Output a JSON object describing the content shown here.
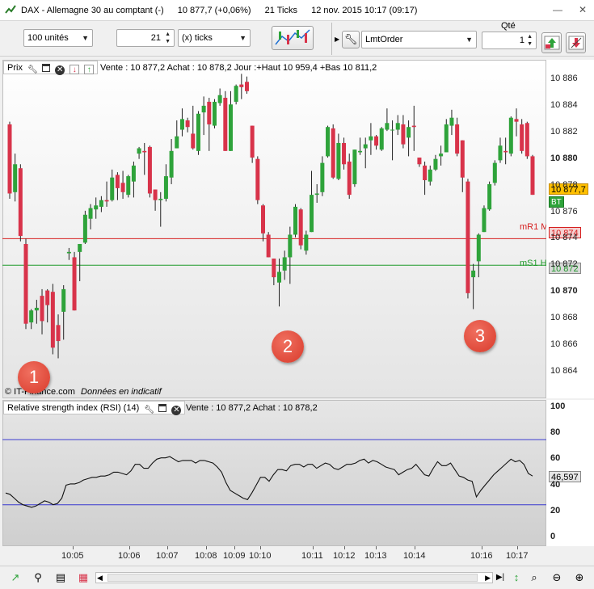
{
  "window": {
    "title_instrument": "DAX - Allemagne 30 au comptant (-)",
    "title_quote": "10 877,7 (+0,06%)",
    "title_ticks": "21 Ticks",
    "title_date": "12 nov. 2015 10:17 (09:17)"
  },
  "toolbar": {
    "units_select": "100 unités",
    "ticks_value": "21",
    "ticks_unit_select": "(x) ticks",
    "order_type_select": "LmtOrder",
    "qty_label": "Qté",
    "qty_value": "1"
  },
  "price_panel": {
    "label": "Prix",
    "info": "Vente : 10 877,2 Achat : 10 878,2 Jour :+Haut 10 959,4 +Bas 10 811,2",
    "watermark_source": "© IT-Finance.com",
    "watermark_note": "Données en indicatif",
    "line_mr1_label": "mR1 M",
    "line_ms1_label": "mS1 H",
    "line_mr1_value": 10874,
    "line_ms1_value": 10872
  },
  "price_axis": {
    "labels": [
      "10 886",
      "10 884",
      "10 882",
      "10 880",
      "10 878",
      "10 876",
      "10 874",
      "10 872",
      "10 870",
      "10 868",
      "10 866",
      "10 864"
    ],
    "bold_labels": [
      "10 880",
      "10 870"
    ],
    "current_tag": "10 877,7",
    "bt_tag": "BT",
    "mr1_tag": "10 874",
    "ms1_tag": "10 872"
  },
  "rsi_panel": {
    "label": "Relative strength index (RSI) (14)",
    "info": "Vente : 10 877,2 Achat : 10 878,2",
    "axis_labels": [
      "100",
      "80",
      "60",
      "40",
      "20",
      "0"
    ],
    "current_value": "46,597"
  },
  "time_axis": [
    "10:05",
    "10:06",
    "10:07",
    "10:08",
    "10:09",
    "10:10",
    "10:11",
    "10:12",
    "10:13",
    "10:14",
    "10:16",
    "10:17"
  ],
  "markers": [
    "1",
    "2",
    "3"
  ],
  "colors": {
    "up": "#2ea33a",
    "down": "#d8334a",
    "mr1": "#d62020",
    "ms1": "#1f9a2a",
    "rsi_bands": "#3a3ad0",
    "current_tag_bg": "#ffc000"
  },
  "chart_data": [
    {
      "type": "candlestick",
      "ylim": [
        10863,
        10887
      ],
      "candles": [
        [
          10882.6,
          10882.8,
          10877,
          10877.4
        ],
        [
          10877.5,
          10880.4,
          10876.8,
          10879.6
        ],
        [
          10879.3,
          10879.6,
          10873.8,
          10874.2
        ],
        [
          10873.6,
          10874,
          10867.2,
          10867.6
        ],
        [
          10867.7,
          10868.7,
          10867.2,
          10868.6
        ],
        [
          10868.6,
          10869.4,
          10867.6,
          10868.8
        ],
        [
          10869.7,
          10870.2,
          10866.8,
          10867.8
        ],
        [
          10870.1,
          10870.2,
          10867.7,
          10869
        ],
        [
          10870,
          10870.6,
          10865.3,
          10865.8
        ],
        [
          10867.5,
          10868.3,
          10865,
          10866.3
        ],
        [
          10868.5,
          10870.5,
          10866.4,
          10870.2
        ],
        [
          10872.9,
          10873.3,
          10872.4,
          10873
        ],
        [
          10872.6,
          10873,
          10868.6,
          10868.6
        ],
        [
          10873,
          10873.6,
          10870.8,
          10873.6
        ],
        [
          10873.7,
          10876.1,
          10873.6,
          10875.8
        ],
        [
          10875.5,
          10876.6,
          10874.7,
          10876.3
        ],
        [
          10876.2,
          10877.1,
          10875.5,
          10876.5
        ],
        [
          10876.4,
          10877.2,
          10876,
          10876.9
        ],
        [
          10876.9,
          10878.3,
          10876.4,
          10876.8
        ],
        [
          10876.9,
          10879.2,
          10876.8,
          10878.6
        ],
        [
          10878.8,
          10879,
          10876.9,
          10877.8
        ],
        [
          10878.2,
          10879.1,
          10877,
          10877.5
        ],
        [
          10877.3,
          10878.8,
          10877.1,
          10878.7
        ],
        [
          10878.3,
          10879.8,
          10877.1,
          10879.5
        ],
        [
          10880.4,
          10880.9,
          10880,
          10880.8
        ],
        [
          10880.6,
          10881.2,
          10878.8,
          10880.5
        ],
        [
          10880.9,
          10881,
          10877.1,
          10877.4
        ],
        [
          10877.7,
          10877.7,
          10876.1,
          10876.9
        ],
        [
          10876.9,
          10877.5,
          10874.9,
          10877
        ],
        [
          10877,
          10879.6,
          10876.8,
          10878.7
        ],
        [
          10878.6,
          10881.5,
          10878.1,
          10880.6
        ],
        [
          10880.8,
          10882.9,
          10880.8,
          10881.7
        ],
        [
          10882.2,
          10883.8,
          10881.7,
          10883
        ],
        [
          10882.9,
          10883.1,
          10882,
          10882.4
        ],
        [
          10881.9,
          10884,
          10880.7,
          10880.8
        ],
        [
          10880.6,
          10883.6,
          10880.3,
          10883.4
        ],
        [
          10883.5,
          10884.7,
          10881.8,
          10884
        ],
        [
          10884.3,
          10884.6,
          10880.6,
          10882.6
        ],
        [
          10882.5,
          10884.5,
          10882.3,
          10884.3
        ],
        [
          10884.2,
          10885.3,
          10884,
          10884.8
        ],
        [
          10884.6,
          10885.1,
          10880.6,
          10880.6
        ],
        [
          10880.6,
          10885.1,
          10880.6,
          10884.1
        ],
        [
          10884.3,
          10885.6,
          10884.1,
          10885.5
        ],
        [
          10885.6,
          10886.4,
          10884.5,
          10885.4
        ],
        [
          10885.8,
          10886.2,
          10884.9,
          10885.1
        ],
        [
          10882.5,
          10882.5,
          10879.7,
          10880.1
        ],
        [
          10880,
          10880.2,
          10876.6,
          10876.9
        ],
        [
          10876.5,
          10876.6,
          10873.8,
          10874.4
        ],
        [
          10874.3,
          10874.5,
          10872.6,
          10872.6
        ],
        [
          10872.5,
          10872.5,
          10870.5,
          10871.1
        ],
        [
          10870.7,
          10872.5,
          10868.9,
          10871.5
        ],
        [
          10871.6,
          10873.1,
          10870.9,
          10872.6
        ],
        [
          10872.6,
          10874.9,
          10870.6,
          10874.3
        ],
        [
          10874.3,
          10876.6,
          10874.1,
          10876.4
        ],
        [
          10876.2,
          10876.3,
          10873.2,
          10873.5
        ],
        [
          10873.1,
          10874.6,
          10872.8,
          10874.3
        ],
        [
          10874.5,
          10879.1,
          10874.5,
          10877.3
        ],
        [
          10877.3,
          10878.1,
          10876.7,
          10877.4
        ],
        [
          10877.5,
          10880.2,
          10877.2,
          10879.7
        ],
        [
          10880.2,
          10882.5,
          10880.1,
          10882.4
        ],
        [
          10882.3,
          10882.6,
          10878.5,
          10878.6
        ],
        [
          10878.5,
          10881.9,
          10878.4,
          10881.2
        ],
        [
          10881.2,
          10881.6,
          10879.2,
          10879.6
        ],
        [
          10879.8,
          10880.4,
          10877,
          10877.3
        ],
        [
          10878.1,
          10880.7,
          10877.9,
          10880.7
        ],
        [
          10880.5,
          10881.6,
          10880.3,
          10880.6
        ],
        [
          10880.8,
          10881.6,
          10879.3,
          10881.1
        ],
        [
          10881.4,
          10882.7,
          10880.3,
          10881.7
        ],
        [
          10881.7,
          10881.8,
          10880.7,
          10881
        ],
        [
          10880.7,
          10882.4,
          10880.6,
          10882.3
        ],
        [
          10882.2,
          10883.8,
          10882.1,
          10882.7
        ],
        [
          10882.2,
          10882.9,
          10879.9,
          10882.2
        ],
        [
          10882.2,
          10883.3,
          10881.8,
          10882.7
        ],
        [
          10882.6,
          10883.3,
          10880.8,
          10881.1
        ],
        [
          10881.6,
          10882.9,
          10880.2,
          10882.4
        ],
        [
          10882.5,
          10884,
          10880.6,
          10882.4
        ],
        [
          10880.1,
          10880.1,
          10879.4,
          10879.6
        ],
        [
          10879.5,
          10879.8,
          10877.3,
          10878.4
        ],
        [
          10878.3,
          10879.5,
          10878,
          10879.2
        ],
        [
          10879.2,
          10880.3,
          10879.1,
          10880
        ],
        [
          10880.2,
          10881,
          10879.5,
          10880.4
        ],
        [
          10880.5,
          10883,
          10880.5,
          10882.6
        ],
        [
          10882.5,
          10883.7,
          10881.8,
          10883.1
        ],
        [
          10882.6,
          10883.1,
          10880.2,
          10880.4
        ],
        [
          10881.4,
          10881.4,
          10877.5,
          10878.6
        ],
        [
          10878.3,
          10878.5,
          10869.5,
          10869.9
        ],
        [
          10871.1,
          10872.1,
          10868.7,
          10871.6
        ],
        [
          10872.3,
          10874.4,
          10871.1,
          10874.3
        ],
        [
          10874.5,
          10876.5,
          10874.5,
          10876.3
        ],
        [
          10876.2,
          10878.3,
          10876.1,
          10878.1
        ],
        [
          10878.2,
          10879.9,
          10878,
          10879.7
        ],
        [
          10879.9,
          10881.6,
          10879.7,
          10881
        ],
        [
          10880.6,
          10881.6,
          10879.6,
          10880.5
        ],
        [
          10880.4,
          10883.2,
          10880.2,
          10883.1
        ],
        [
          10883,
          10883.8,
          10881.7,
          10882.8
        ],
        [
          10882.6,
          10883,
          10880.4,
          10880.6
        ],
        [
          10882.7,
          10882.8,
          10880,
          10880.2
        ],
        [
          10880.2,
          10880.3,
          10877.3,
          10877.3
        ]
      ]
    },
    {
      "type": "line",
      "name": "RSI",
      "ylim": [
        0,
        100
      ],
      "bands": [
        75,
        25
      ],
      "values": [
        34,
        33,
        30,
        27,
        25,
        24,
        23,
        24,
        26,
        28,
        27,
        25,
        26,
        30,
        40,
        41,
        41,
        42,
        44,
        45,
        46,
        46,
        47,
        47,
        48,
        50,
        50,
        49,
        48,
        51,
        56,
        56,
        53,
        53,
        57,
        60,
        61,
        61,
        62,
        60,
        58,
        59,
        59,
        59,
        57,
        59,
        59,
        58,
        57,
        54,
        50,
        42,
        36,
        34,
        32,
        30,
        29,
        34,
        40,
        46,
        46,
        43,
        48,
        52,
        52,
        51,
        55,
        56,
        56,
        54,
        56,
        56,
        53,
        55,
        57,
        56,
        53,
        52,
        54,
        56,
        56,
        57,
        59,
        60,
        57,
        59,
        58,
        56,
        54,
        53,
        52,
        48,
        50,
        52,
        53,
        56,
        52,
        48,
        47,
        53,
        58,
        55,
        55,
        57,
        52,
        47,
        46,
        44,
        43,
        31,
        36,
        40,
        44,
        48,
        51,
        54,
        57,
        60,
        58,
        59,
        56,
        49,
        47
      ]
    }
  ]
}
